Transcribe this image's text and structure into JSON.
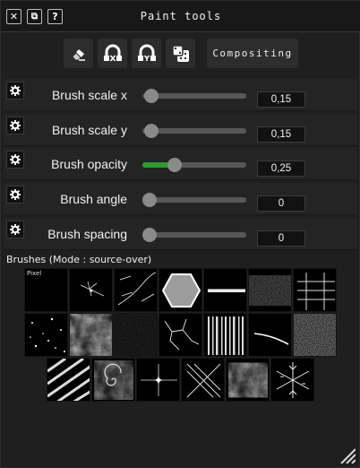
{
  "window": {
    "title": "Paint tools",
    "buttons": [
      {
        "glyph": "✕",
        "icon": "close-icon"
      },
      {
        "glyph": "⧉",
        "icon": "detach-icon"
      },
      {
        "glyph": "?",
        "icon": "help-icon"
      }
    ]
  },
  "toolbar": {
    "tools": [
      "eraser-icon",
      "lock-x-icon",
      "lock-y-icon",
      "dice-icon"
    ],
    "compositing_label": "Compositing"
  },
  "sliders": [
    {
      "label": "Brush scale x",
      "value": "0,15",
      "level": 0.02,
      "active": false
    },
    {
      "label": "Brush scale y",
      "value": "0,15",
      "level": 0.02,
      "active": false
    },
    {
      "label": "Brush opacity",
      "value": "0,25",
      "level": 0.25,
      "active": true
    },
    {
      "label": "Brush angle",
      "value": "0",
      "level": 0.0,
      "active": false
    },
    {
      "label": "Brush spacing",
      "value": "0",
      "level": 0.0,
      "active": false
    }
  ],
  "brushes": {
    "heading": "Brushes (Mode : source-over)",
    "first_label": "Pixel",
    "items": [
      "pixel-brush",
      "splatter-brush",
      "scratch-brush",
      "hexagon-brush",
      "line-brush",
      "noise-brush",
      "grid-brush",
      "dots-brush",
      "cloud-brush",
      "speckle-brush",
      "crack-brush",
      "stripes-brush",
      "stroke-brush",
      "static-brush",
      "diagonal-brush",
      "swirl-brush",
      "star-brush",
      "cross-brush",
      "smoke-brush",
      "snowflake-brush"
    ]
  },
  "colors": {
    "accent": "#2e9a2e",
    "background": "#1f1f1f"
  }
}
